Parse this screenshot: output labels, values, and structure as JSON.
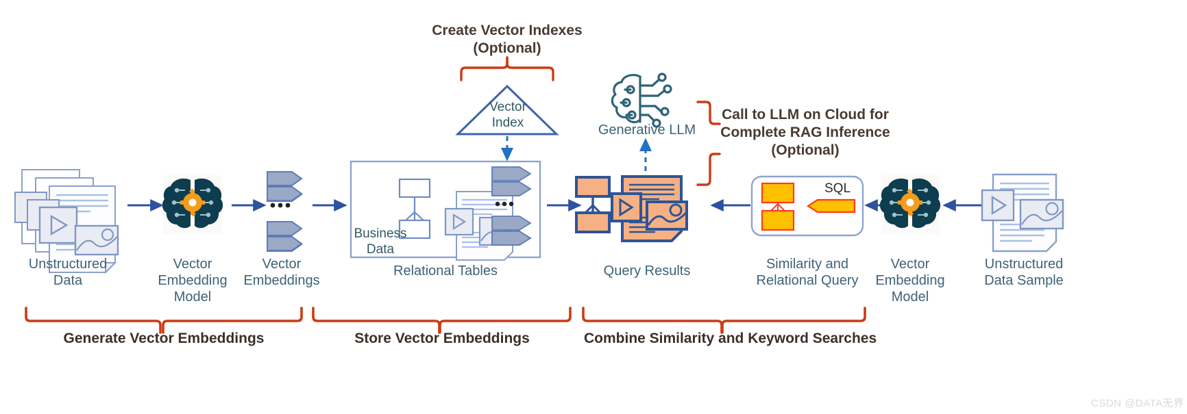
{
  "diagram": {
    "title_hidden": "",
    "colors": {
      "bracket_red": "#cc3b14",
      "arrow_blue": "#2c52a0",
      "dashed_blue": "#1f72c4",
      "label_teal": "#3d6275",
      "heading_brown": "#493a33",
      "doc_outline": "#7a93c4",
      "doc_fill": "#ffffff",
      "vector_fill": "#9aa9c6",
      "vector_stroke": "#5e7cb8",
      "panel_stroke": "#8ea3cf",
      "orange_fill": "#f5b183",
      "orange_stroke": "#2e5496",
      "sql_yellow": "#ffc000",
      "sql_red": "#ff3b1f",
      "brain_dark": "#0d3d4e",
      "brain_gear": "#f59c1a"
    }
  },
  "headings": [
    {
      "name": "create-vector-indexes",
      "text": "Create Vector Indexes\n(Optional)"
    },
    {
      "name": "call-to-llm",
      "text": "Call to LLM on Cloud for\nComplete RAG Inference\n(Optional)"
    }
  ],
  "nodes": [
    {
      "name": "unstructured-data",
      "label": "Unstructured\nData"
    },
    {
      "name": "vector-embedding-model-left",
      "label": "Vector\nEmbedding\nModel"
    },
    {
      "name": "vector-embeddings",
      "label": "Vector\nEmbeddings"
    },
    {
      "name": "relational-tables",
      "label": "Relational Tables"
    },
    {
      "name": "business-data",
      "label": "Business\nData"
    },
    {
      "name": "vector-index",
      "label": "Vector\nIndex"
    },
    {
      "name": "generative-llm",
      "label": "Generative LLM"
    },
    {
      "name": "query-results",
      "label": "Query Results"
    },
    {
      "name": "similarity-relational-query",
      "label": "Similarity and\nRelational Query"
    },
    {
      "name": "sql-badge",
      "label": "SQL"
    },
    {
      "name": "vector-embedding-model-right",
      "label": "Vector\nEmbedding\nModel"
    },
    {
      "name": "unstructured-data-sample",
      "label": "Unstructured\nData Sample"
    }
  ],
  "phases": [
    {
      "name": "generate-vector-embeddings",
      "label": "Generate Vector Embeddings"
    },
    {
      "name": "store-vector-embeddings",
      "label": "Store Vector Embeddings"
    },
    {
      "name": "combine-searches",
      "label": "Combine Similarity and Keyword Searches"
    }
  ],
  "watermark": {
    "text": "CSDN @DATA无界"
  },
  "icons": [
    "documents-stack-icon",
    "brain-chip-icon",
    "vector-arrow-stack-icon",
    "relational-table-icon",
    "triangle-index-icon",
    "generative-brain-icon",
    "query-results-icon",
    "sql-query-icon",
    "plus-icon",
    "document-sample-icon"
  ]
}
